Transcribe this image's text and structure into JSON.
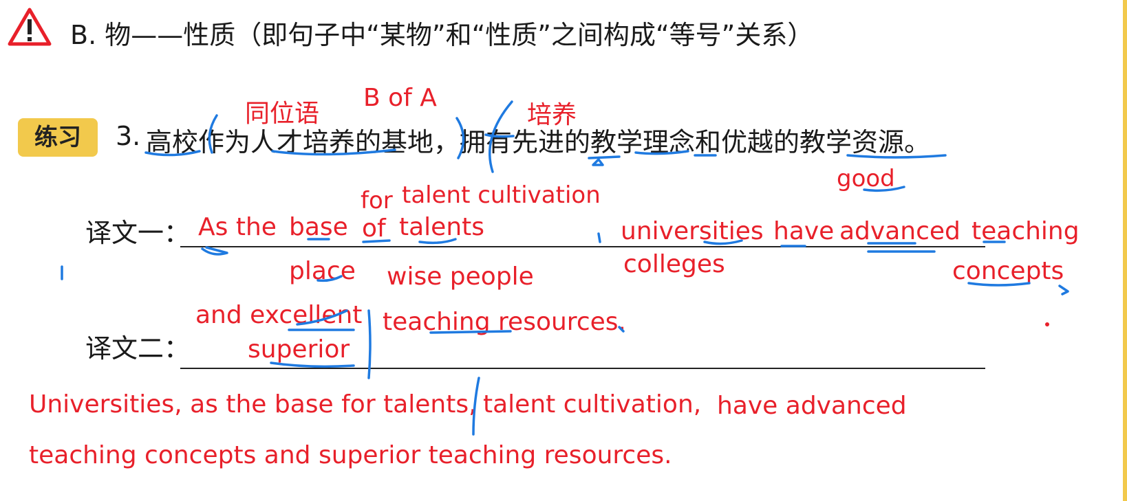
{
  "heading": {
    "icon": "warning-triangle-icon",
    "text": "B. 物——性质（即句子中“某物”和“性质”之间构成“等号”关系）"
  },
  "exercise": {
    "badge": "练习",
    "number": "3.",
    "sentence": "高校作为人才培养的基地，拥有先进的教学理念和优越的教学资源。"
  },
  "labels": {
    "translation_one": "译文一：",
    "translation_two": "译文二："
  },
  "annotations": {
    "appositive": "同位语",
    "b_of_a": "B of A",
    "cultivate": "培养",
    "good": "good",
    "for": "for",
    "talent_cultivation": "talent cultivation",
    "as_the": "As the",
    "base": "base",
    "of": "of",
    "talents": "talents",
    "universities": "universities",
    "have": "have",
    "advanced": "advanced",
    "teaching": "teaching",
    "place": "place",
    "wise_people": "wise people",
    "colleges": "colleges",
    "concepts": "concepts",
    "and_excellent": "and excellent",
    "superior": "superior",
    "teaching_resources": "teaching resources.",
    "final_line_1a": "Universities,  as the base for talents,",
    "final_line_1b": "talent cultivation,",
    "final_line_1c": "have advanced",
    "final_line_2": "teaching concepts and superior teaching resources."
  },
  "colors": {
    "ink_red": "#e8202a",
    "ink_blue": "#1f7ae0",
    "badge_yellow": "#f2c94c",
    "warning_red": "#e8202a"
  }
}
